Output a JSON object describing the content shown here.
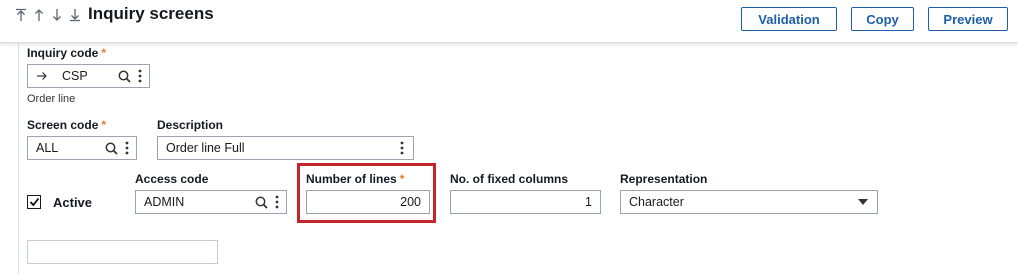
{
  "header": {
    "title": "Inquiry screens",
    "buttons": {
      "validation": "Validation",
      "copy": "Copy",
      "preview": "Preview"
    },
    "nav_icons": [
      "first-record-icon",
      "previous-record-icon",
      "next-record-icon",
      "last-record-icon"
    ]
  },
  "form": {
    "inquiry_code": {
      "label": "Inquiry code",
      "required_mark": "*",
      "value": "CSP",
      "description": "Order line"
    },
    "screen_code": {
      "label": "Screen code",
      "required_mark": "*",
      "value": "ALL"
    },
    "description": {
      "label": "Description",
      "value": "Order line Full"
    },
    "active": {
      "label": "Active",
      "checked": true
    },
    "access_code": {
      "label": "Access code",
      "value": "ADMIN"
    },
    "number_of_lines": {
      "label": "Number of lines",
      "required_mark": "*",
      "value": "200"
    },
    "fixed_columns": {
      "label": "No. of fixed columns",
      "value": "1"
    },
    "representation": {
      "label": "Representation",
      "value": "Character"
    },
    "extra_field": {
      "value": ""
    }
  },
  "colors": {
    "accent": "#1d5ea8",
    "required": "#e07b39",
    "highlight": "#c2272d",
    "field_border": "#9aa5b0"
  }
}
